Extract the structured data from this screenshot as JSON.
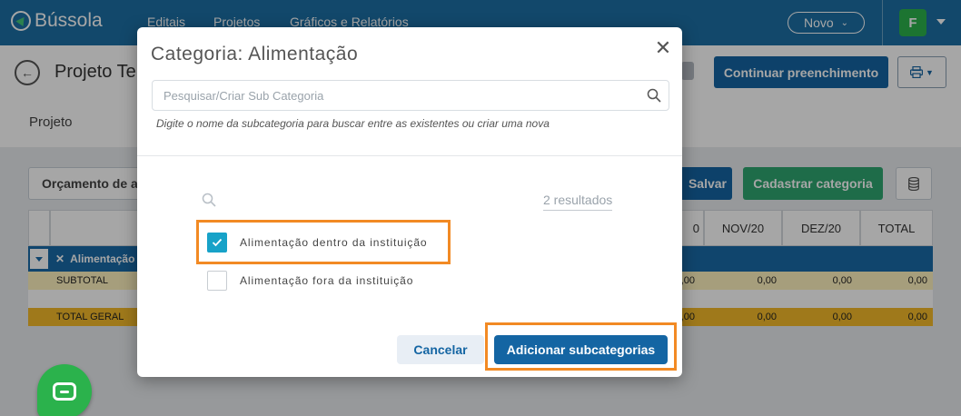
{
  "navbar": {
    "logo_text": "Bússola",
    "links": [
      "Editais",
      "Projetos",
      "Gráficos e Relatórios"
    ],
    "novo_label": "Novo",
    "avatar_initial": "F"
  },
  "header": {
    "page_title": "Projeto Te",
    "continuar_label": "Continuar preenchimento",
    "projeto_tab": "Projeto"
  },
  "toolbar": {
    "orcamento_label": "Orçamento de al",
    "salvar_label": "Salvar",
    "cadastrar_label": "Cadastrar categoria"
  },
  "table": {
    "columns": [
      "0",
      "NOV/20",
      "DEZ/20",
      "TOTAL"
    ],
    "category_label": "Alimentação",
    "subtotal_label": "SUBTOTAL",
    "total_label": "TOTAL GERAL",
    "subtotal_values": [
      ",00",
      "0,00",
      "0,00",
      "0,00"
    ],
    "total_values": [
      ",00",
      "0,00",
      "0,00",
      "0,00"
    ]
  },
  "modal": {
    "title": "Categoria: Alimentação",
    "search_placeholder": "Pesquisar/Criar Sub Categoria",
    "help_text": "Digite o nome da subcategoria para buscar entre as existentes ou criar uma nova",
    "results_count": "2 resultados",
    "options": [
      {
        "label": "Alimentação dentro da instituição",
        "checked": true
      },
      {
        "label": "Alimentação fora da instituição",
        "checked": false
      }
    ],
    "cancel_label": "Cancelar",
    "add_label": "Adicionar subcategorias"
  },
  "colors": {
    "navbar": "#1d6fa5",
    "primary_button": "#1465a3",
    "success_button": "#2ea671",
    "checkbox_checked": "#17a2c8",
    "highlight": "#f28a24"
  }
}
